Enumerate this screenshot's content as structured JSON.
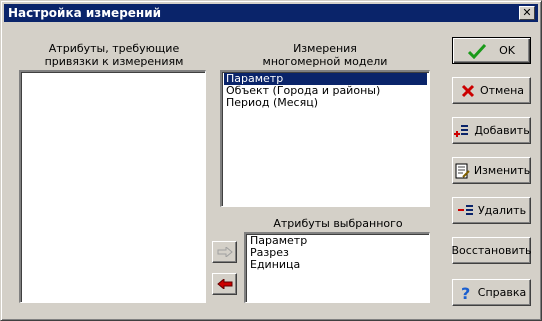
{
  "window": {
    "title": "Настройка измерений",
    "close_glyph": "✕"
  },
  "left_panel": {
    "caption_line1": "Атрибуты, требующие",
    "caption_line2": "привязки к измерениям",
    "items": []
  },
  "dimensions_panel": {
    "caption_line1": "Измерения",
    "caption_line2": "многомерной модели",
    "items": [
      "Параметр",
      "Объект (Города и районы)",
      "Период (Месяц)"
    ],
    "selected_index": 0
  },
  "attributes_panel": {
    "caption": "Атрибуты выбранного измерения",
    "items": [
      "Параметр",
      "Разрез",
      "Единица"
    ]
  },
  "buttons": {
    "ok": "OK",
    "cancel": "Отмена",
    "add": "Добавить",
    "edit": "Изменить",
    "delete": "Удалить",
    "restore": "Восстановить",
    "help": "Справка"
  },
  "icons": {
    "ok": "checkmark-icon",
    "cancel": "red-x-icon",
    "add": "add-item-icon",
    "edit": "edit-document-icon",
    "delete": "remove-item-icon",
    "help": "question-mark-icon",
    "move_right": "arrow-right-icon",
    "move_left": "arrow-left-icon"
  },
  "colors": {
    "titlebar": "#0a246a",
    "selection": "#0a246a",
    "face": "#d4d0c8",
    "ok_check": "#1a9a1a",
    "cancel_x": "#cc0000",
    "arrow_left": "#cc0000",
    "help_icon": "#1a5fd0"
  }
}
